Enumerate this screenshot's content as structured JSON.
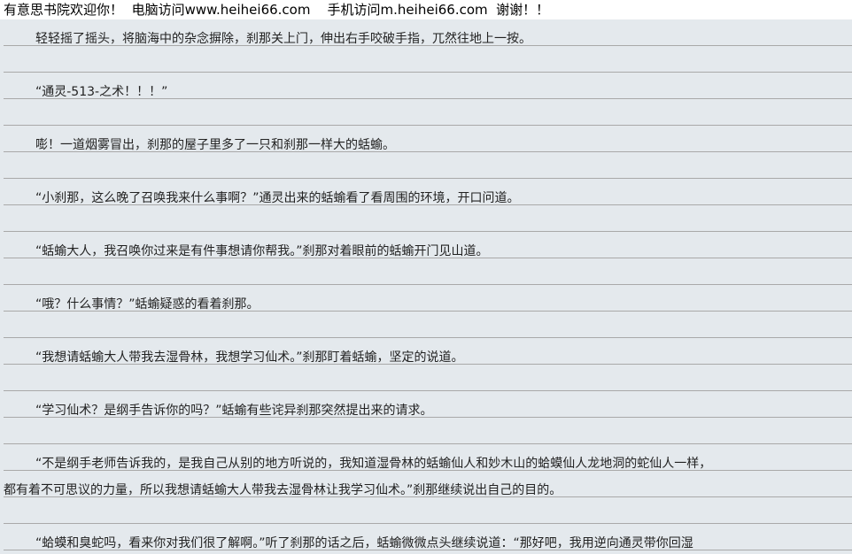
{
  "banner": {
    "site_name": "有意思书院欢迎你！",
    "pc_text": "电脑访问www.heihei66.com",
    "mobile_text": "手机访问m.heihei66.com",
    "thanks": "谢谢！！"
  },
  "paragraphs": [
    {
      "lines": [
        "轻轻摇了摇头，将脑海中的杂念摒除，刹那关上门，伸出右手咬破手指，兀然往地上一按。"
      ]
    },
    {
      "lines": [
        "“通灵-513-之术！！！”"
      ]
    },
    {
      "lines": [
        "嘭！一道烟雾冒出，刹那的屋子里多了一只和刹那一样大的蛞蝓。"
      ]
    },
    {
      "lines": [
        "“小刹那，这么晚了召唤我来什么事啊？”通灵出来的蛞蝓看了看周围的环境，开口问道。"
      ]
    },
    {
      "lines": [
        "“蛞蝓大人，我召唤你过来是有件事想请你帮我。”刹那对着眼前的蛞蝓开门见山道。"
      ]
    },
    {
      "lines": [
        "“哦？什么事情？”蛞蝓疑惑的看着刹那。"
      ]
    },
    {
      "lines": [
        "“我想请蛞蝓大人带我去湿骨林，我想学习仙术。”刹那盯着蛞蝓，坚定的说道。"
      ]
    },
    {
      "lines": [
        "“学习仙术？是纲手告诉你的吗？”蛞蝓有些诧异刹那突然提出来的请求。"
      ]
    },
    {
      "lines": [
        "“不是纲手老师告诉我的，是我自己从别的地方听说的，我知道湿骨林的蛞蝓仙人和妙木山的蛤蟆仙人龙地洞的蛇仙人一样，",
        "都有着不可思议的力量，所以我想请蛞蝓大人带我去湿骨林让我学习仙术。”刹那继续说出自己的目的。"
      ]
    },
    {
      "lines": [
        "“蛤蟆和臭蛇吗，看来你对我们很了解啊。”听了刹那的话之后，蛞蝓微微点头继续说道：“那好吧，我用逆向通灵带你回湿"
      ]
    }
  ]
}
